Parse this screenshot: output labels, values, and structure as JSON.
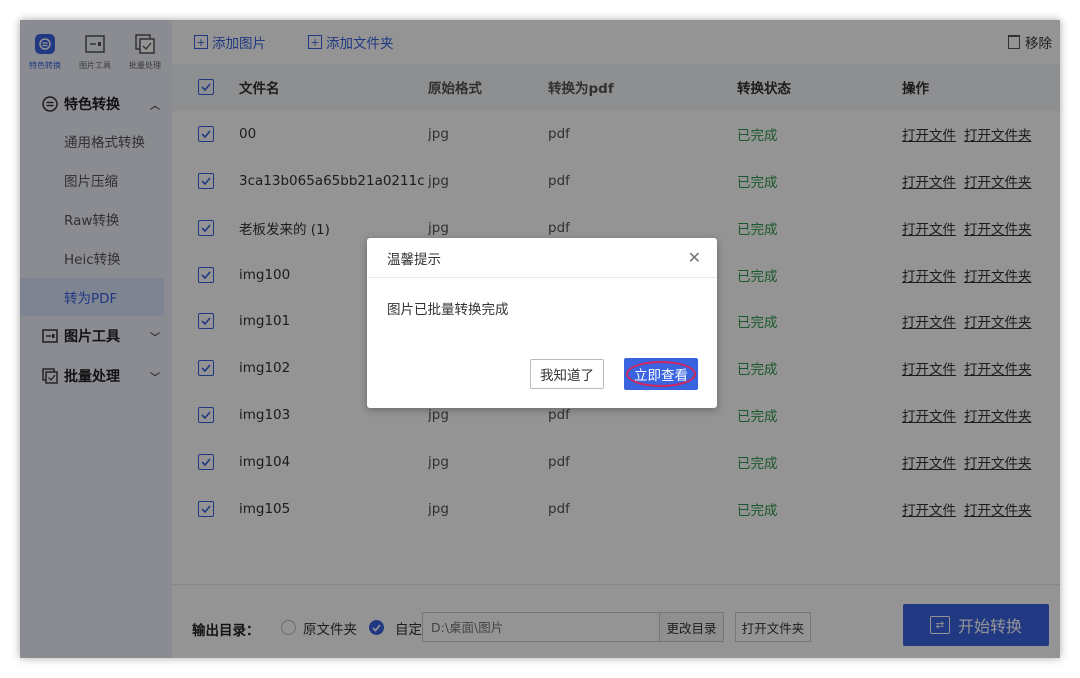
{
  "sidebar": {
    "top_tabs": [
      {
        "label": "特色转换",
        "icon": "feature-convert-icon",
        "active": true
      },
      {
        "label": "图片工具",
        "icon": "image-tool-icon",
        "active": false
      },
      {
        "label": "批量处理",
        "icon": "batch-icon",
        "active": false
      }
    ],
    "groups": {
      "feature": {
        "label": "特色转换",
        "expanded": true
      },
      "image_tools": {
        "label": "图片工具",
        "expanded": false
      },
      "batch": {
        "label": "批量处理",
        "expanded": false
      }
    },
    "items": [
      {
        "label": "通用格式转换"
      },
      {
        "label": "图片压缩"
      },
      {
        "label": "Raw转换"
      },
      {
        "label": "Heic转换"
      },
      {
        "label": "转为PDF",
        "active": true
      }
    ]
  },
  "toolbar": {
    "add_image": "添加图片",
    "add_folder": "添加文件夹",
    "remove": "移除"
  },
  "table": {
    "headers": {
      "name": "文件名",
      "format": "原始格式",
      "pdf": "转换为pdf",
      "status": "转换状态",
      "ops": "操作"
    },
    "rows": [
      {
        "name": "00",
        "format": "jpg",
        "pdf": "pdf",
        "status": "已完成"
      },
      {
        "name": "3ca13b065a65bb21a0211ca8...",
        "format": "jpg",
        "pdf": "pdf",
        "status": "已完成"
      },
      {
        "name": "老板发来的 (1)",
        "format": "jpg",
        "pdf": "pdf",
        "status": "已完成"
      },
      {
        "name": "img100",
        "format": "jpg",
        "pdf": "pdf",
        "status": "已完成"
      },
      {
        "name": "img101",
        "format": "jpg",
        "pdf": "pdf",
        "status": "已完成"
      },
      {
        "name": "img102",
        "format": "jpg",
        "pdf": "pdf",
        "status": "已完成"
      },
      {
        "name": "img103",
        "format": "jpg",
        "pdf": "pdf",
        "status": "已完成"
      },
      {
        "name": "img104",
        "format": "jpg",
        "pdf": "pdf",
        "status": "已完成"
      },
      {
        "name": "img105",
        "format": "jpg",
        "pdf": "pdf",
        "status": "已完成"
      }
    ],
    "open_file": "打开文件",
    "open_folder": "打开文件夹"
  },
  "footer": {
    "output_label": "输出目录：",
    "radio_original": "原文件夹",
    "radio_custom": "自定义",
    "path_placeholder": "D:\\桌面\\图片",
    "change_dir": "更改目录",
    "open_folder": "打开文件夹",
    "start": "开始转换"
  },
  "modal": {
    "title": "温馨提示",
    "message": "图片已批量转换完成",
    "ok": "我知道了",
    "view": "立即查看"
  },
  "colors": {
    "accent": "#3a63e0",
    "success": "#2e9a4b",
    "highlight_ring": "#d0265b"
  }
}
